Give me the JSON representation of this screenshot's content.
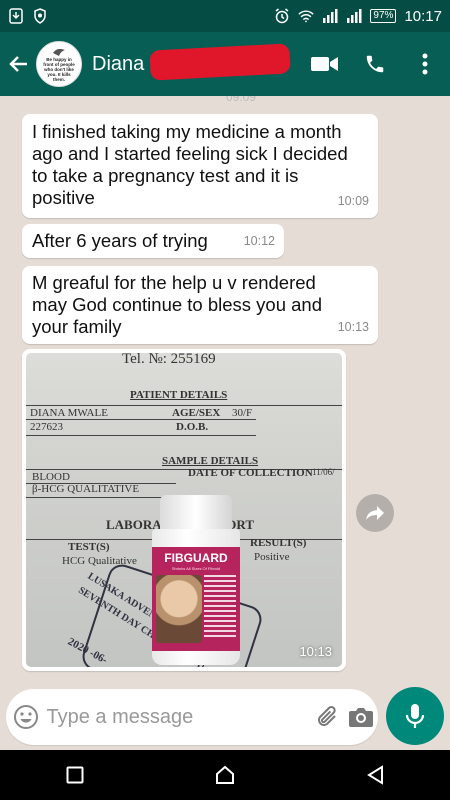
{
  "status_bar": {
    "time": "10:17",
    "battery": "97",
    "icons": [
      "download-icon",
      "shield-icon",
      "alarm-icon",
      "wifi-icon",
      "signal-icon",
      "signal-icon",
      "battery-icon"
    ]
  },
  "header": {
    "contact_name": "Diana K",
    "avatar_text": "Be happy in front of people who don't like you. It kills them."
  },
  "chat": {
    "cut_timestamp": "09:09",
    "messages": [
      {
        "text": "I finished taking my medicine a month ago and I started feeling sick I decided to take a pregnancy test and it is positive",
        "time": "10:09"
      },
      {
        "text": "After 6 years of trying",
        "time": "10:12"
      },
      {
        "text": "M greaful for the help u v rendered may God continue to bless you and your family",
        "time": "10:13"
      }
    ],
    "image_message": {
      "time": "10:13",
      "document": {
        "tel": "Tel. №: 255169",
        "patient_details": "PATIENT DETAILS",
        "name": "DIANA MWALE",
        "id": "227623",
        "age_sex_label": "AGE/SEX",
        "age_sex": "30/F",
        "dob_label": "D.O.B.",
        "sample_details": "SAMPLE DETAILS",
        "blood": "BLOOD",
        "hcg": "β-HCG QUALITATIVE",
        "date_label": "DATE OF COLLECTION",
        "date": "11/06/",
        "lab_report": "LABORATORY REPORT",
        "tests_label": "TEST(S)",
        "test_name": "HCG Qualitative",
        "result_label": "RESULT(S)",
        "result": "Positive",
        "stamp_line1": "LUSAKA ADVENTIST CLINIC",
        "stamp_line2": "SEVENTH DAY CHURCH (SDA)",
        "stamp_date": "2020 -06-"
      },
      "product": {
        "brand": "FIBGUARD",
        "tagline": "Shrinks All Sizes Of Fibroid"
      }
    }
  },
  "input": {
    "placeholder": "Type a message"
  },
  "colors": {
    "header": "#075e54",
    "status_bar": "#054d44",
    "chat_bg": "#e5ddd5",
    "accent": "#00897b"
  }
}
